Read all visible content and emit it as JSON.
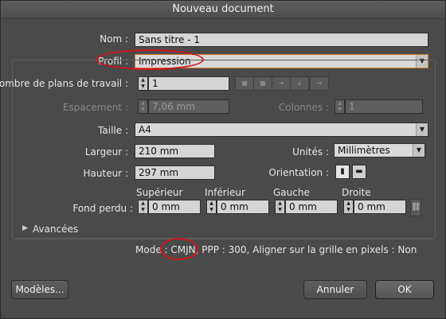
{
  "window": {
    "title": "Nouveau document"
  },
  "name": {
    "label": "Nom :",
    "value": "Sans titre - 1"
  },
  "profile": {
    "label": "Profil :",
    "value": "Impression"
  },
  "artboards": {
    "label": "Nombre de plans de travail :",
    "value": "1"
  },
  "spacing": {
    "label": "Espacement :",
    "value": "7,06 mm"
  },
  "columns": {
    "label": "Colonnes :",
    "value": "1"
  },
  "size": {
    "label": "Taille :",
    "value": "A4"
  },
  "width": {
    "label": "Largeur :",
    "value": "210 mm"
  },
  "units": {
    "label": "Unités :",
    "value": "Millimètres"
  },
  "height": {
    "label": "Hauteur :",
    "value": "297 mm"
  },
  "orientation": {
    "label": "Orientation :"
  },
  "bleed": {
    "label": "Fond perdu :",
    "top": {
      "label": "Supérieur",
      "value": "0 mm"
    },
    "bottom": {
      "label": "Inférieur",
      "value": "0 mm"
    },
    "left": {
      "label": "Gauche",
      "value": "0 mm"
    },
    "right": {
      "label": "Droite",
      "value": "0 mm"
    }
  },
  "advanced": {
    "label": "Avancées"
  },
  "mode_info": {
    "prefix": "Mode :",
    "mode": "CMJN",
    "rest": ", PPP : 300, Aligner sur la grille en pixels : Non"
  },
  "buttons": {
    "templates": "Modèles...",
    "cancel": "Annuler",
    "ok": "OK"
  },
  "highlight_color": "#d4141e"
}
